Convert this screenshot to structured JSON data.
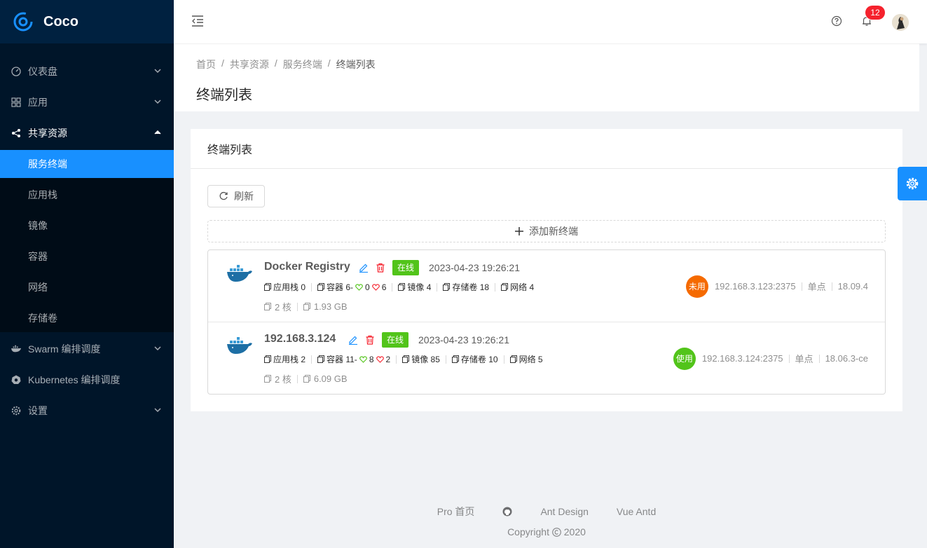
{
  "app": {
    "name": "Coco"
  },
  "menu": {
    "dashboard": "仪表盘",
    "apps": "应用",
    "shared": "共享资源",
    "shared_items": [
      "服务终端",
      "应用栈",
      "镜像",
      "容器",
      "网络",
      "存储卷"
    ],
    "swarm": "Swarm 编排调度",
    "kubernetes": "Kubernetes 编排调度",
    "settings": "设置"
  },
  "header": {
    "notification_count": "12"
  },
  "breadcrumb": [
    "首页",
    "共享资源",
    "服务终端",
    "终端列表"
  ],
  "page_title": "终端列表",
  "card": {
    "title": "终端列表",
    "refresh_label": "刷新",
    "add_label": "添加新终端"
  },
  "endpoints": [
    {
      "name": "Docker Registry",
      "status": "在线",
      "time": "2023-04-23 19:26:21",
      "stacks": "应用栈 0",
      "containers": "容器 6-",
      "healthy": "0",
      "unhealthy": "6",
      "images": "镜像 4",
      "volumes": "存储卷 18",
      "networks": "网络 4",
      "cpu": "2 核",
      "memory": "1.93 GB",
      "usage": "未用",
      "usage_color": "#f56a00",
      "address": "192.168.3.123:2375",
      "mode": "单点",
      "version": "18.09.4"
    },
    {
      "name": "192.168.3.124",
      "status": "在线",
      "time": "2023-04-23 19:26:21",
      "stacks": "应用栈 2",
      "containers": "容器 11-",
      "healthy": "8",
      "unhealthy": "2",
      "images": "镜像 85",
      "volumes": "存储卷 10",
      "networks": "网络 5",
      "cpu": "2 核",
      "memory": "6.09 GB",
      "usage": "使用",
      "usage_color": "#52c41a",
      "address": "192.168.3.124:2375",
      "mode": "单点",
      "version": "18.06.3-ce"
    }
  ],
  "footer": {
    "links": [
      "Pro 首页",
      "Ant Design",
      "Vue Antd"
    ],
    "copyright": "Copyright",
    "year": "2020"
  },
  "colors": {
    "primary": "#1890ff",
    "sider": "#001529",
    "success": "#52c41a",
    "danger": "#f5222d"
  }
}
